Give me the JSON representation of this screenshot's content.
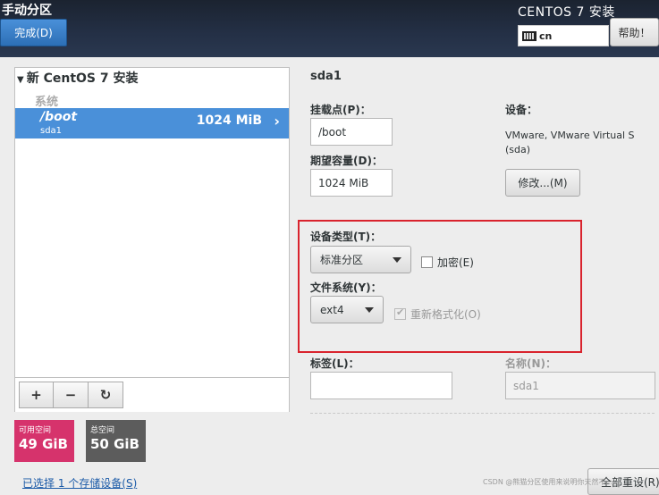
{
  "header": {
    "title": "手动分区",
    "done_label": "完成(D)",
    "distro": "CENTOS 7 安装",
    "keyboard_layout": "cn",
    "help_label": "帮助！"
  },
  "left": {
    "root_label": "新 CentOS 7 安装",
    "group_label": "系统",
    "partition": {
      "name": "/boot",
      "device": "sda1",
      "size": "1024 MiB"
    },
    "toolbar": {
      "add": "+",
      "remove": "−",
      "refresh": "↻"
    },
    "available": {
      "label": "可用空间",
      "value": "49 GiB"
    },
    "total": {
      "label": "总空间",
      "value": "50 GiB"
    },
    "storage_link": "已选择 1 个存储设备(S)"
  },
  "right": {
    "title": "sda1",
    "mount_label": "挂载点(P)：",
    "mount_value": "/boot",
    "capacity_label": "期望容量(D)：",
    "capacity_value": "1024 MiB",
    "device_label": "设备：",
    "device_text": "VMware, VMware Virtual S (sda)",
    "modify_label": "修改...(M)",
    "device_type_label": "设备类型(T)：",
    "device_type_value": "标准分区",
    "encrypt_label": "加密(E)",
    "fs_label": "文件系统(Y)：",
    "fs_value": "ext4",
    "reformat_label": "重新格式化(O)",
    "tag_label": "标签(L)：",
    "tag_value": "",
    "name_label": "名称(N)：",
    "name_value": "sda1",
    "reset_label": "全部重设(R)"
  },
  "watermark": "CSDN @熊猫分区使用来说明你天然不..."
}
